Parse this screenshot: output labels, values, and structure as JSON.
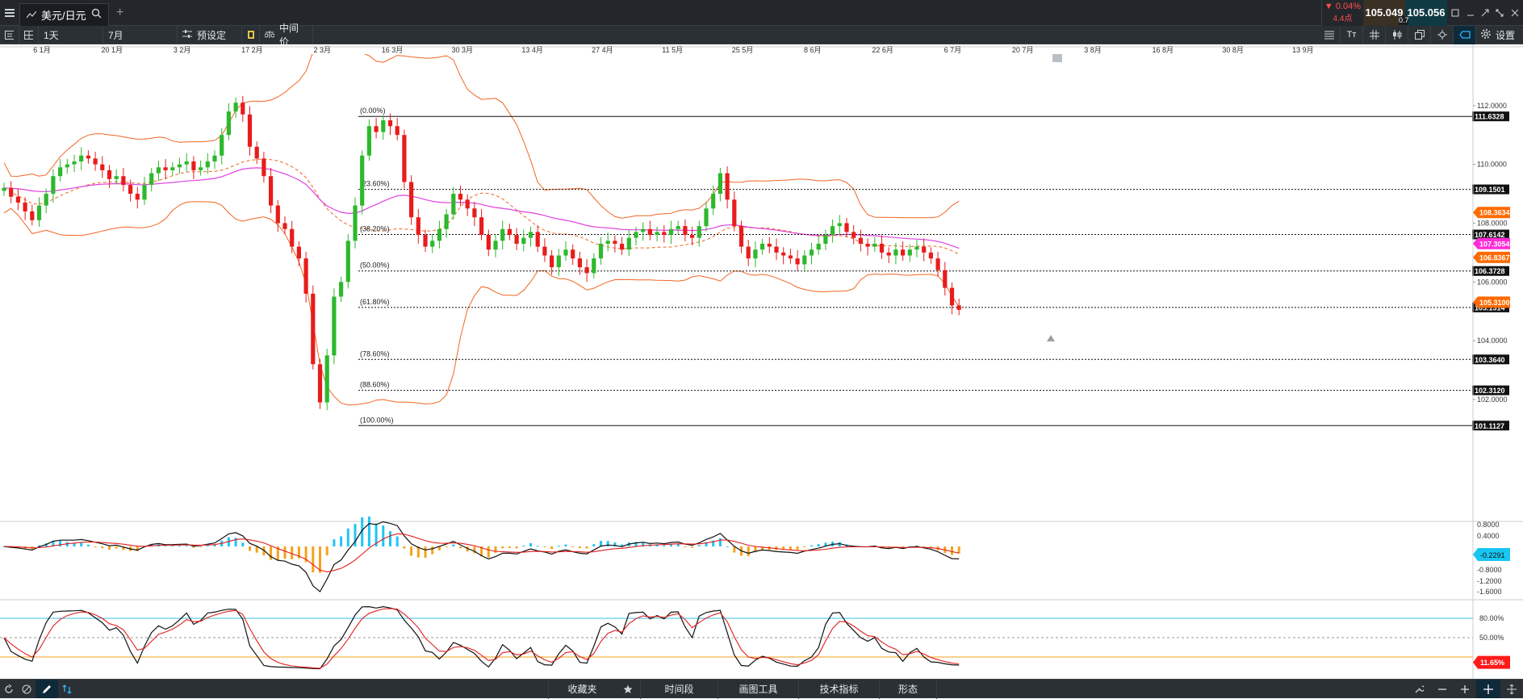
{
  "titlebar": {
    "tab_label": "美元/日元",
    "change_pct": "▼ 0.04%",
    "change_pts": "4.4点",
    "bid": "105.049",
    "ask": "105.056",
    "spread": "0.7",
    "colors": {
      "down": "#ff4d4d",
      "bid_bg": "#2f2a20",
      "ask_bg": "#0f2c33"
    }
  },
  "toolbar": {
    "timeframe": "1天",
    "period": "7月",
    "preset": "预设定",
    "price_type": "中间价",
    "settings": "设置"
  },
  "bottombar": {
    "favorites": "收藏夹",
    "timeframe": "时间段",
    "drawing_tools": "画图工具",
    "indicators": "技术指标",
    "patterns": "形态"
  },
  "chart_data": {
    "type": "candlestick",
    "x_ticks": [
      "6 1月",
      "20 1月",
      "3 2月",
      "17 2月",
      "2 3月",
      "16 3月",
      "30 3月",
      "13 4月",
      "27 4月",
      "11 5月",
      "25 5月",
      "8 6月",
      "22 6月",
      "6 7月",
      "20 7月",
      "3 8月",
      "16 8月",
      "30 8月",
      "13 9月"
    ],
    "y_ticks": [
      "112.0000",
      "110.0000",
      "108.0000",
      "106.0000",
      "104.0000",
      "102.0000"
    ],
    "ylim": [
      100.9,
      114.0
    ],
    "fib_levels": [
      {
        "label": "(0.00%)",
        "value": 111.6328,
        "tag": "111.6328"
      },
      {
        "label": "(23.60%)",
        "value": 109.1501,
        "tag": "109.1501"
      },
      {
        "label": "(38.20%)",
        "value": 107.6142,
        "tag": "107.6142"
      },
      {
        "label": "(50.00%)",
        "value": 106.3728,
        "tag": "106.3728"
      },
      {
        "label": "(61.80%)",
        "value": 105.1314,
        "tag": "105.1314"
      },
      {
        "label": "(78.60%)",
        "value": 103.364,
        "tag": "103.3640"
      },
      {
        "label": "(88.60%)",
        "value": 102.312,
        "tag": "102.3120"
      },
      {
        "label": "(100.00%)",
        "value": 101.1127,
        "tag": "101.1127"
      }
    ],
    "price_tags": [
      {
        "value": 108.3634,
        "text": "108.3634",
        "color": "#ff6a00"
      },
      {
        "value": 107.3054,
        "text": "107.3054",
        "color": "#ff2bd6"
      },
      {
        "value": 106.8367,
        "text": "106.8367",
        "color": "#ff6a00"
      },
      {
        "value": 105.31,
        "text": "105.3100",
        "color": "#ff6a00"
      }
    ],
    "closes": [
      109.2,
      108.9,
      108.7,
      108.4,
      108.1,
      108.6,
      109.0,
      109.6,
      109.9,
      110.0,
      110.1,
      110.3,
      110.2,
      110.0,
      109.8,
      109.5,
      109.6,
      109.3,
      109.0,
      108.8,
      109.3,
      109.7,
      109.9,
      109.8,
      109.9,
      110.0,
      110.1,
      109.8,
      109.9,
      110.1,
      110.3,
      111.0,
      111.8,
      112.1,
      111.7,
      110.6,
      110.2,
      109.6,
      108.6,
      108.0,
      107.8,
      107.2,
      106.8,
      105.6,
      103.2,
      101.9,
      103.5,
      105.5,
      106.0,
      107.4,
      108.6,
      110.3,
      111.3,
      111.1,
      111.5,
      111.3,
      111.0,
      109.4,
      108.2,
      107.6,
      107.2,
      107.4,
      107.8,
      108.3,
      109.0,
      108.8,
      108.5,
      108.2,
      107.6,
      107.1,
      107.4,
      107.8,
      107.6,
      107.3,
      107.5,
      107.7,
      107.2,
      106.9,
      106.5,
      106.9,
      107.1,
      106.8,
      106.5,
      106.3,
      106.8,
      107.3,
      107.4,
      107.3,
      107.1,
      107.5,
      107.7,
      107.8,
      107.6,
      107.7,
      107.6,
      107.8,
      107.9,
      107.6,
      107.5,
      107.9,
      108.5,
      109.0,
      109.7,
      108.8,
      107.9,
      107.2,
      106.8,
      107.1,
      107.3,
      107.2,
      107.0,
      106.9,
      106.8,
      106.6,
      106.9,
      107.1,
      107.3,
      107.6,
      107.9,
      108.0,
      107.7,
      107.5,
      107.3,
      107.2,
      107.3,
      107.0,
      106.9,
      107.1,
      106.9,
      107.1,
      107.2,
      107.0,
      106.8,
      106.4,
      105.8,
      105.2,
      105.05
    ],
    "macd_ticks": [
      "0.8000",
      "0.4000",
      "-0.8000",
      "-1.2000",
      "-1.6000"
    ],
    "macd_tag": "-0.2291",
    "stoch_ticks": [
      "80.00%",
      "50.00%"
    ],
    "stoch_tag": "11.65%"
  }
}
